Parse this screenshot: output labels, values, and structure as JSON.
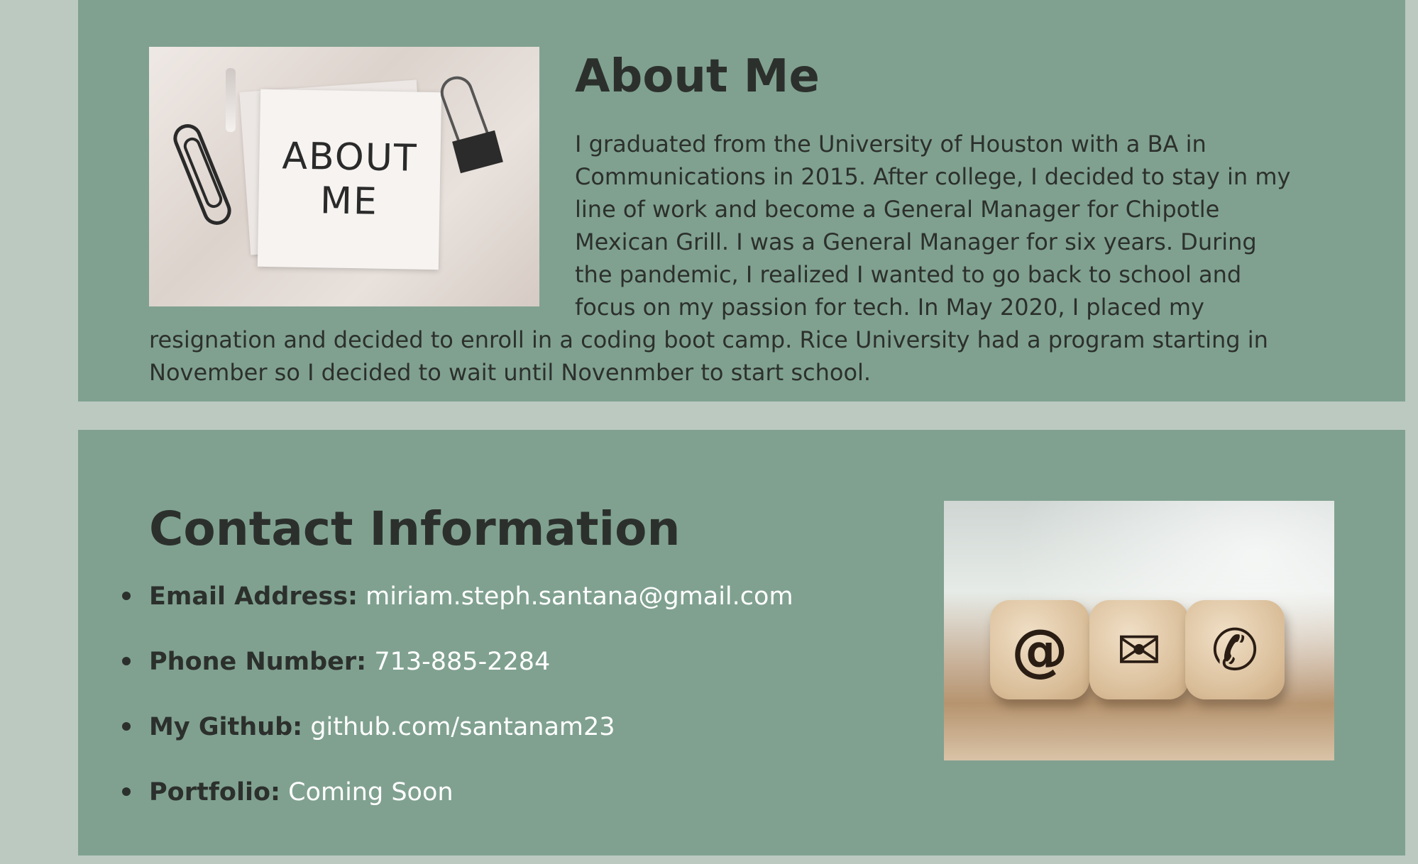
{
  "about": {
    "title": "About Me",
    "image_text": "ABOUT\nME",
    "body": "I graduated from the University of Houston with a BA in Communications in 2015. After college, I decided to stay in my line of work and become a General Manager for Chipotle Mexican Grill. I was a General Manager for six years. During the pandemic, I realized I wanted to go back to school and focus on my passion for tech. In May 2020, I placed my resignation and decided to enroll in a coding boot camp. Rice University had a program starting in November so I decided to wait until Novenmber to start school."
  },
  "contact": {
    "title": "Contact Information",
    "items": [
      {
        "label": "Email Address:",
        "value": "miriam.steph.santana@gmail.com"
      },
      {
        "label": "Phone Number:",
        "value": "713-885-2284"
      },
      {
        "label": "My Github:",
        "value": "github.com/santanam23"
      },
      {
        "label": "Portfolio:",
        "value": "Coming Soon"
      }
    ],
    "image_icons": [
      "at-icon",
      "envelope-icon",
      "phone-icon"
    ]
  },
  "colors": {
    "page_background": "#bbc9c1",
    "section_background": "#80a190",
    "text_dark": "#2c302d",
    "link_text": "#ffffff"
  }
}
